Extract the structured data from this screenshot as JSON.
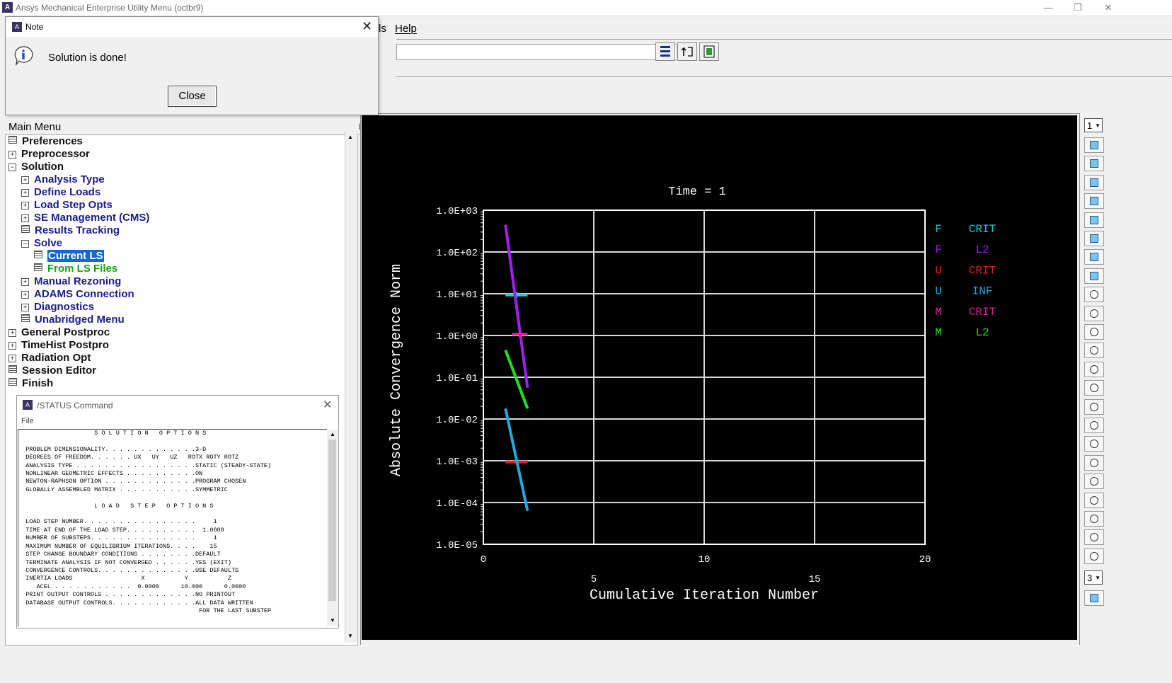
{
  "window": {
    "title": "Ansys Mechanical Enterprise Utility Menu (octbr9)",
    "icon_letter": "A"
  },
  "menubar": {
    "partial_label": "ls",
    "help_label": "Help"
  },
  "main_menu": {
    "title": "Main Menu",
    "collapse_glyph": "⌃",
    "items": [
      {
        "label": "Preferences",
        "depth": 0,
        "icon": "leaf",
        "color": "black"
      },
      {
        "label": "Preprocessor",
        "depth": 0,
        "icon": "plus",
        "color": "black"
      },
      {
        "label": "Solution",
        "depth": 0,
        "icon": "minus",
        "color": "black"
      },
      {
        "label": "Analysis Type",
        "depth": 1,
        "icon": "plus",
        "color": "blue"
      },
      {
        "label": "Define Loads",
        "depth": 1,
        "icon": "plus",
        "color": "blue"
      },
      {
        "label": "Load Step Opts",
        "depth": 1,
        "icon": "plus",
        "color": "blue"
      },
      {
        "label": "SE Management (CMS)",
        "depth": 1,
        "icon": "plus",
        "color": "blue"
      },
      {
        "label": "Results Tracking",
        "depth": 1,
        "icon": "leaf",
        "color": "blue"
      },
      {
        "label": "Solve",
        "depth": 1,
        "icon": "minus",
        "color": "blue"
      },
      {
        "label": "Current LS",
        "depth": 2,
        "icon": "leaf",
        "color": "selected"
      },
      {
        "label": "From LS Files",
        "depth": 2,
        "icon": "leaf",
        "color": "green"
      },
      {
        "label": "Manual Rezoning",
        "depth": 1,
        "icon": "plus",
        "color": "blue"
      },
      {
        "label": "ADAMS Connection",
        "depth": 1,
        "icon": "plus",
        "color": "blue"
      },
      {
        "label": "Diagnostics",
        "depth": 1,
        "icon": "plus",
        "color": "blue"
      },
      {
        "label": "Unabridged Menu",
        "depth": 1,
        "icon": "leaf",
        "color": "blue"
      },
      {
        "label": "General Postproc",
        "depth": 0,
        "icon": "plus",
        "color": "black"
      },
      {
        "label": "TimeHist Postpro",
        "depth": 0,
        "icon": "plus",
        "color": "black"
      },
      {
        "label": "Radiation Opt",
        "depth": 0,
        "icon": "plus",
        "color": "black"
      },
      {
        "label": "Session Editor",
        "depth": 0,
        "icon": "leaf",
        "color": "black"
      },
      {
        "label": "Finish",
        "depth": 0,
        "icon": "leaf",
        "color": "black"
      }
    ]
  },
  "note_dialog": {
    "title": "Note",
    "message": "Solution is done!",
    "close_label": "Close",
    "close_glyph": "✕"
  },
  "status_dialog": {
    "title": "/STATUS  Command",
    "menu_file": "File",
    "close_glyph": "✕",
    "text": "                     S O L U T I O N   O P T I O N S\n\n  PROBLEM DIMENSIONALITY. . . . . . . . . . . . .3-D\n  DEGREES OF FREEDOM. . . . . . UX   UY   UZ   ROTX ROTY ROTZ\n  ANALYSIS TYPE . . . . . . . . . . . . . . . . .STATIC (STEADY-STATE)\n  NONLINEAR GEOMETRIC EFFECTS . . . . . . . . . .ON\n  NEWTON-RAPHSON OPTION . . . . . . . . . . . . .PROGRAM CHOSEN\n  GLOBALLY ASSEMBLED MATRIX . . . . . . . . . . .SYMMETRIC\n\n                     L O A D   S T E P   O P T I O N S\n\n  LOAD STEP NUMBER. . . . . . . . . . . . . . . .     1\n  TIME AT END OF THE LOAD STEP. . . . . . . . . .  1.0000\n  NUMBER OF SUBSTEPS. . . . . . . . . . . . . . .     1\n  MAXIMUM NUMBER OF EQUILIBRIUM ITERATIONS. . . .    15\n  STEP CHANGE BOUNDARY CONDITIONS . . . . . . . .DEFAULT\n  TERMINATE ANALYSIS IF NOT CONVERGED . . . . . .YES (EXIT)\n  CONVERGENCE CONTROLS. . . . . . . . . . . . . .USE DEFAULTS\n  INERTIA LOADS                   X           Y           Z\n     ACEL . . . . . . . . . . .  0.0000      10.000      0.0000\n  PRINT OUTPUT CONTROLS . . . . . . . . . . . . .NO PRINTOUT\n  DATABASE OUTPUT CONTROLS. . . . . . . . . . . .ALL DATA WRITTEN\n                                                  FOR THE LAST SUBSTEP"
  },
  "right_toolbar": {
    "window_select": "1",
    "view_select": "3"
  },
  "chart_data": {
    "type": "line",
    "title": "Time = 1",
    "xlabel": "Cumulative Iteration Number",
    "ylabel": "Absolute Convergence Norm",
    "x_ticks": [
      0,
      5,
      10,
      15,
      20
    ],
    "xlim": [
      0,
      20
    ],
    "y_scale": "log",
    "y_ticks": [
      "1.0E+03",
      "1.0E+02",
      "1.0E+01",
      "1.0E+00",
      "1.0E-01",
      "1.0E-02",
      "1.0E-03",
      "1.0E-04",
      "1.0E-05"
    ],
    "ylim": [
      -5,
      3
    ],
    "grid": true,
    "legend_position": "right",
    "background": "#000000",
    "series": [
      {
        "name": "F CRIT",
        "label1": "F",
        "label2": "CRIT",
        "color": "#20c8e0",
        "kind": "criterion",
        "x": [
          1.0,
          2.0
        ],
        "log_y": [
          0.97,
          0.97
        ]
      },
      {
        "name": "F L2",
        "label1": "F",
        "label2": "L2",
        "color": "#a020f0",
        "kind": "line",
        "x": [
          1.0,
          2.0
        ],
        "log_y": [
          2.65,
          -1.25
        ]
      },
      {
        "name": "U CRIT",
        "label1": "U",
        "label2": "CRIT",
        "color": "#e02020",
        "kind": "criterion",
        "x": [
          1.0,
          2.0
        ],
        "log_y": [
          -3.03,
          -3.03
        ]
      },
      {
        "name": "U INF",
        "label1": "U",
        "label2": "INF",
        "color": "#20a8e0",
        "kind": "line",
        "x": [
          1.0,
          2.0
        ],
        "log_y": [
          -1.75,
          -4.2
        ]
      },
      {
        "name": "M CRIT",
        "label1": "M",
        "label2": "CRIT",
        "color": "#e020a0",
        "kind": "criterion",
        "x": [
          1.3,
          2.0
        ],
        "log_y": [
          0.03,
          0.03
        ]
      },
      {
        "name": "M L2",
        "label1": "M",
        "label2": "L2",
        "color": "#20e020",
        "kind": "line",
        "x": [
          1.0,
          2.0
        ],
        "log_y": [
          -0.35,
          -1.75
        ]
      }
    ]
  }
}
